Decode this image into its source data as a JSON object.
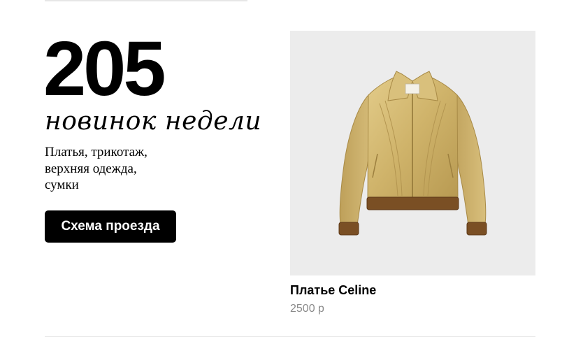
{
  "promo": {
    "count": "205",
    "subtitle": "новинок недели",
    "categories_lines": [
      "Платья, трикотаж,",
      "верхняя одежда,",
      "сумки"
    ],
    "button_label": "Схема проезда"
  },
  "product": {
    "name": "Платье Celine",
    "price": "2500 р",
    "image_icon": "gold-leather-jacket-image"
  },
  "colors": {
    "button_bg": "#000000",
    "button_text": "#ffffff",
    "price_text": "#8a8a8a",
    "image_bg": "#ececec"
  }
}
